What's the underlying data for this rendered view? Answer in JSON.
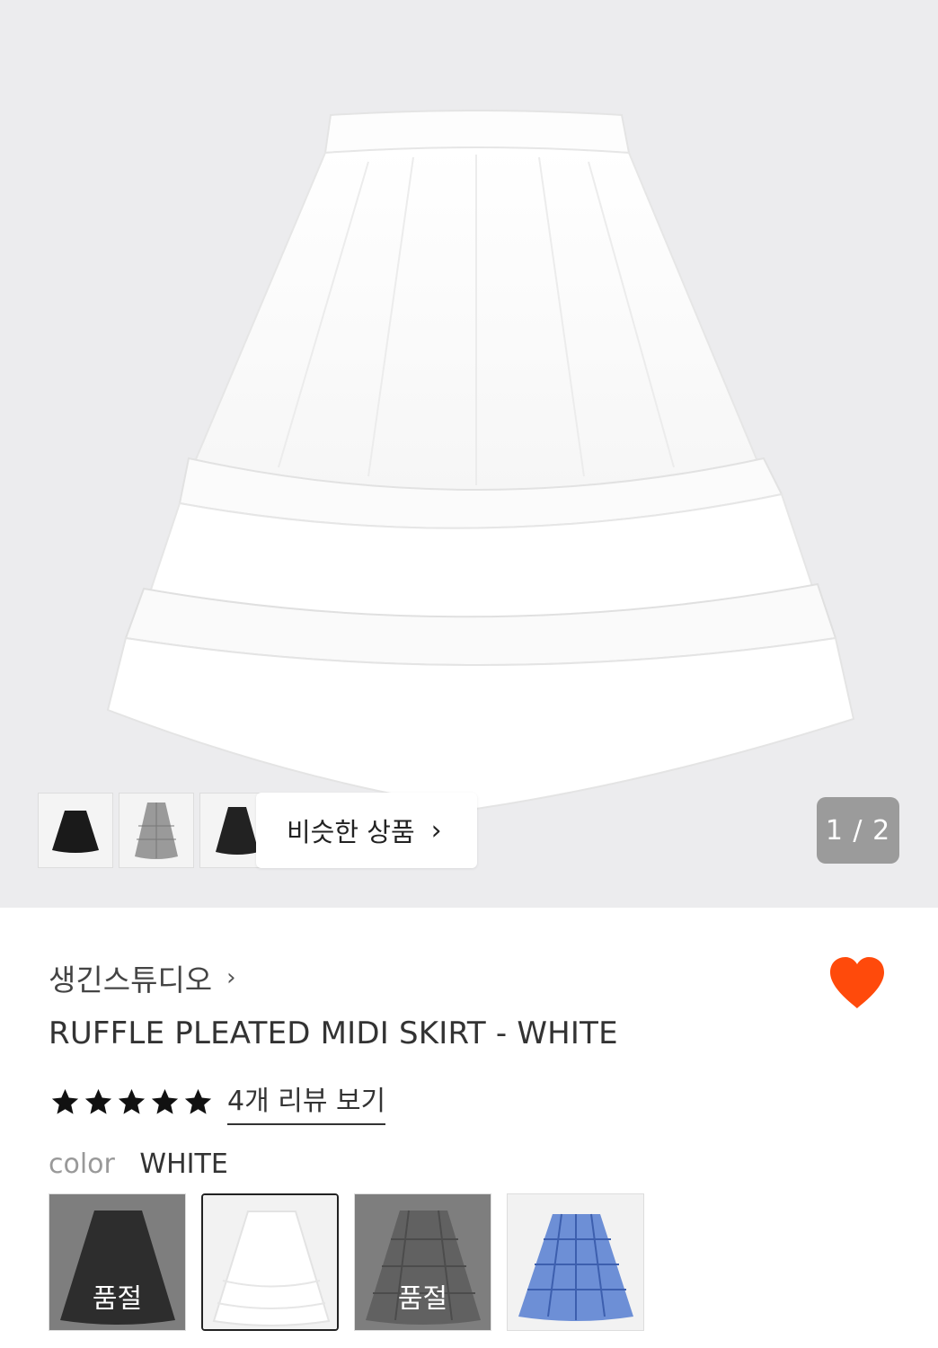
{
  "gallery": {
    "similar_label": "비슷한 상품",
    "page_indicator": "1 / 2",
    "thumbnails": [
      "black",
      "gray-check",
      "black-tulle"
    ]
  },
  "product": {
    "brand": "생긴스튜디오",
    "title": "RUFFLE PLEATED MIDI SKIRT - WHITE",
    "rating_stars": 5,
    "review_link": "4개 리뷰 보기",
    "color_label": "color",
    "color_value": "WHITE",
    "wishlist_color": "#ff4a0b"
  },
  "colors": [
    {
      "name": "black",
      "sold_out": "품절"
    },
    {
      "name": "white",
      "selected": true
    },
    {
      "name": "gray-check",
      "sold_out": "품절"
    },
    {
      "name": "blue-check"
    }
  ]
}
